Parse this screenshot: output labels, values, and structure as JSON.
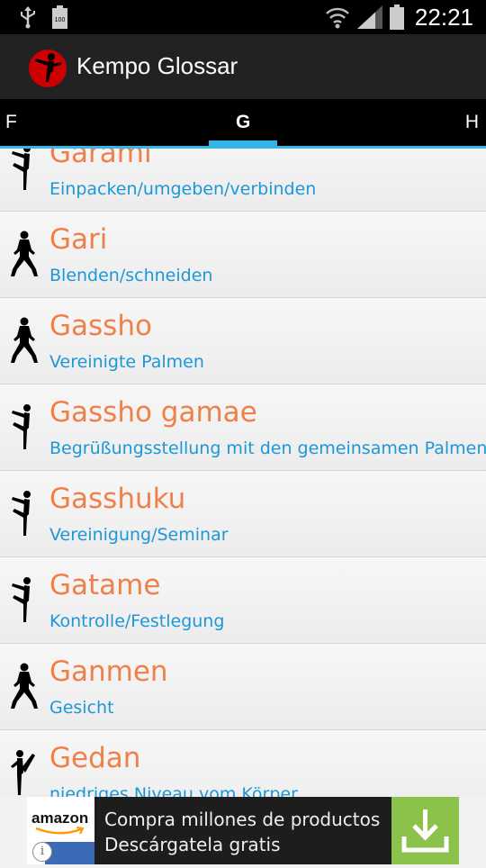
{
  "status": {
    "time": "22:21",
    "battery_left_label": "100"
  },
  "app": {
    "title": "Kempo Glossar"
  },
  "tabs": {
    "left": "F",
    "center": "G",
    "right": "H"
  },
  "entries": [
    {
      "term": "Garami",
      "meaning": "Einpacken/umgeben/verbinden",
      "figure": "kick-figure"
    },
    {
      "term": "Gari",
      "meaning": "Blenden/schneiden",
      "figure": "stance-figure"
    },
    {
      "term": "Gassho",
      "meaning": "Vereinigte Palmen",
      "figure": "stance-figure"
    },
    {
      "term": "Gassho gamae",
      "meaning": "Begrüßungsstellung mit den gemeinsamen Palmen",
      "figure": "kick-figure"
    },
    {
      "term": "Gasshuku",
      "meaning": "Vereinigung/Seminar",
      "figure": "kick-figure"
    },
    {
      "term": "Gatame",
      "meaning": "Kontrolle/Festlegung",
      "figure": "kick-figure"
    },
    {
      "term": "Ganmen",
      "meaning": "Gesicht",
      "figure": "stance-figure"
    },
    {
      "term": "Gedan",
      "meaning": "niedriges Niveau vom Körper",
      "figure": "high-kick-figure"
    }
  ],
  "ad": {
    "brand": "amazon",
    "line1": "Compra millones de productos",
    "line2": "Descárgatela gratis",
    "info_glyph": "i",
    "download_icon": "download-icon",
    "accent": "#8bc34a"
  },
  "colors": {
    "term": "#f0804a",
    "meaning": "#1c97d8",
    "tab_indicator": "#33b5e5",
    "logo": "#cc0000"
  }
}
